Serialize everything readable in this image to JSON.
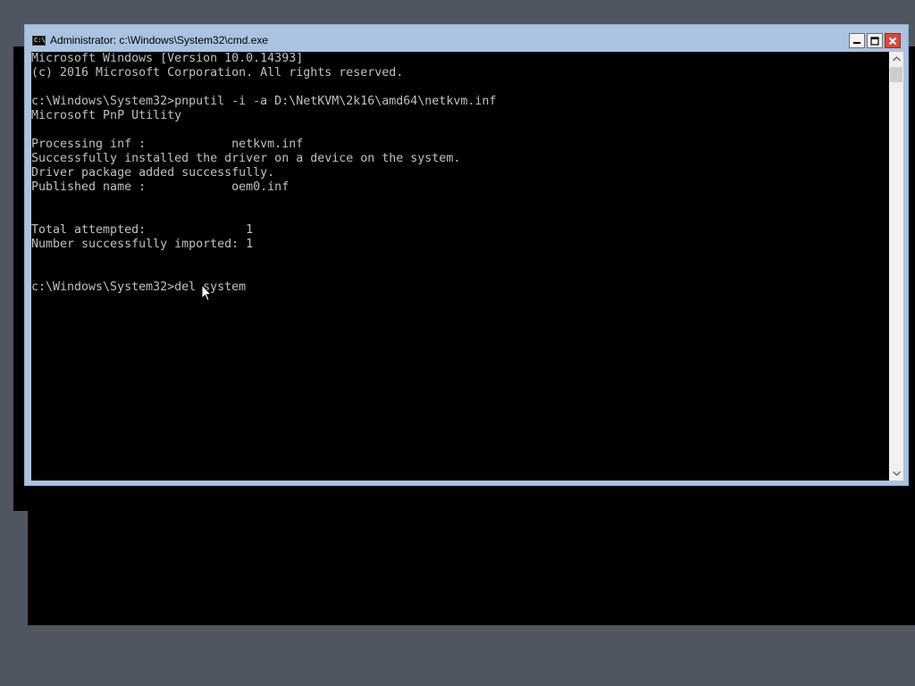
{
  "window": {
    "title": "Administrator: c:\\Windows\\System32\\cmd.exe",
    "icon_text": "C:\\.",
    "controls": {
      "minimize": "minimize-icon",
      "maximize": "maximize-icon",
      "close": "close-icon"
    }
  },
  "console": {
    "foreground": "#c0c0c0",
    "background": "#000000",
    "lines": [
      "Microsoft Windows [Version 10.0.14393]",
      "(c) 2016 Microsoft Corporation. All rights reserved.",
      "",
      "c:\\Windows\\System32>pnputil -i -a D:\\NetKVM\\2k16\\amd64\\netkvm.inf",
      "Microsoft PnP Utility",
      "",
      "Processing inf :            netkvm.inf",
      "Successfully installed the driver on a device on the system.",
      "Driver package added successfully.",
      "Published name :            oem0.inf",
      "",
      "",
      "Total attempted:              1",
      "Number successfully imported: 1",
      "",
      "",
      "c:\\Windows\\System32>del system"
    ]
  },
  "scrollbar": {
    "up": "chevron-up-icon",
    "down": "chevron-down-icon"
  },
  "colors": {
    "desktop": "#4f5660",
    "title_bar": "#a9c3e0",
    "close_button": "#d64a3a"
  }
}
